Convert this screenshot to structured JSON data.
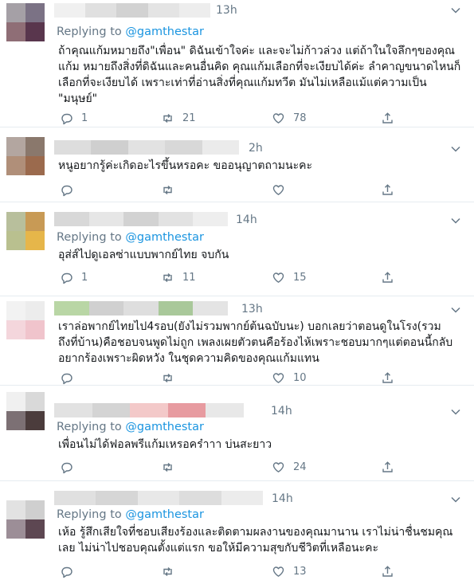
{
  "tweets": [
    {
      "time": "13h",
      "reply_prefix": "Replying to",
      "reply_handle": "@gamthestar",
      "lines": [
        "ถ้าคุณแก้มหมายถึง\"เพื่อน\"  ดิฉันเข้าใจค่ะ และจะไม่ก้าวล่วง แต่ถ้าในใจลึกๆของคุณ",
        "แก้ม หมายถึงสิ่งที่ดิฉันและคนอื่นคิด คุณแก้มเลือกที่จะเงียบได้ค่ะ ลำคาญขนาดไหนก็",
        "เลือกที่จะเงียบได้ เพราะเท่าที่อ่านสิ่งที่คุณแก้มทวีต มันไม่เหลือแม้แต่ความเป็น",
        "\"มนุษย์\""
      ],
      "replies": "1",
      "retweets": "21",
      "likes": "78",
      "avatar_colors": [
        "#a5a0a6",
        "#7b7285",
        "#8f6e76",
        "#59364d",
        "#eeeeee",
        "#e5dde3",
        "#ffffff",
        "#ffffff"
      ],
      "name_colors": [
        "#f0f0f0",
        "#e0e0e0",
        "#d2d2d2",
        "#e4e4e4",
        "#ededed"
      ]
    },
    {
      "time": "2h",
      "reply_prefix": "",
      "reply_handle": "",
      "lines": [
        "หนูอยากรู้ค่ะเกิดอะไรขึ้นหรอคะ ขออนุญาตถามนะคะ"
      ],
      "replies": "",
      "retweets": "",
      "likes": "",
      "avatar_colors": [
        "#b3a6a0",
        "#8a786c",
        "#b08f79",
        "#9b6a4d",
        "#f7f3ee",
        "#f5efe6",
        "#ffffff",
        "#ffffff"
      ],
      "name_colors": [
        "#dddddd",
        "#cfcfcf",
        "#e2e2e2",
        "#d8d8d8",
        "#ebebeb"
      ]
    },
    {
      "time": "14h",
      "reply_prefix": "Replying to",
      "reply_handle": "@gamthestar",
      "lines": [
        "อุส่ส์ไปดูเอลซ่าแบบพากย์ไทย จบกัน"
      ],
      "replies": "1",
      "retweets": "11",
      "likes": "15",
      "avatar_colors": [
        "#b8bf9c",
        "#c89a55",
        "#b9c08f",
        "#e6b64a",
        "#ffffff",
        "#fbf6e8",
        "#ffffff",
        "#ffffff"
      ],
      "name_colors": [
        "#d8d8d8",
        "#e6e6e6",
        "#d2d2d2",
        "#e2e2e2",
        "#eeeeee"
      ]
    },
    {
      "time": "13h",
      "reply_prefix": "",
      "reply_handle": "",
      "lines": [
        "เราล่อพากย์ไทยไป4รอบ(ยังไม่รวมพากย์ต้นฉบับนะ) บอกเลยว่าตอนดูในโรง(รวม",
        "ถึงที่บ้าน)คือชอบจนพูดไม่ถูก เพลงเผยตัวตนคือร้องไห้เพราะชอบมากๆแต่ตอนนี้กลับ",
        "อยากร้องเพราะผิดหวัง ในชุดความคิดของคุณแก้มแทน"
      ],
      "replies": "",
      "retweets": "",
      "likes": "10",
      "avatar_colors": [
        "#f2f2f2",
        "#ececec",
        "#f4d6dc",
        "#f0c4cc",
        "#f5f5f5",
        "#fbe9ec",
        "#ffffff",
        "#ffffff"
      ],
      "name_colors": [
        "#b9d6a5",
        "#d0d0d0",
        "#dedede",
        "#a9c89a",
        "#e4e4e4"
      ]
    },
    {
      "time": "14h",
      "reply_prefix": "Replying to",
      "reply_handle": "@gamthestar",
      "lines": [
        "เพื่อนไม่ได้ฟอลพรีแก้มเหรอคร๋าาา บ่นสะยาว"
      ],
      "replies": "",
      "retweets": "",
      "likes": "24",
      "avatar_colors": [
        "#f0f0f0",
        "#d9d9d9",
        "#7c7074",
        "#4b3c3c",
        "#dcdcdc",
        "#c8aeae",
        "#ffffff",
        "#ffffff"
      ],
      "name_colors": [
        "#e2e2e2",
        "#d4d4d4",
        "#f3c9c9",
        "#e79ba0",
        "#e8e8e8"
      ]
    },
    {
      "time": "14h",
      "reply_prefix": "Replying to",
      "reply_handle": "@gamthestar",
      "lines": [
        "เห้อ รู้สึกเสียใจที่ชอบเสียงร้องและติดตามผลงานของคุณมานาน เราไม่น่าชื่นชมคุณ",
        "เลย ไม่น่าไปชอบคุณตั้งแต่แรก ขอให้มีความสุขกับชีวิตที่เหลือนะคะ"
      ],
      "replies": "",
      "retweets": "",
      "likes": "13",
      "avatar_colors": [
        "#e2e2e2",
        "#cfcfcf",
        "#9c8e97",
        "#5d4752",
        "#e4e4e4",
        "#d7d7d7",
        "#ffffff",
        "#ffffff"
      ],
      "name_colors": [
        "#e0e0e0",
        "#d6d6d6",
        "#e8e8e8",
        "#dddddd",
        "#ececec"
      ]
    }
  ]
}
